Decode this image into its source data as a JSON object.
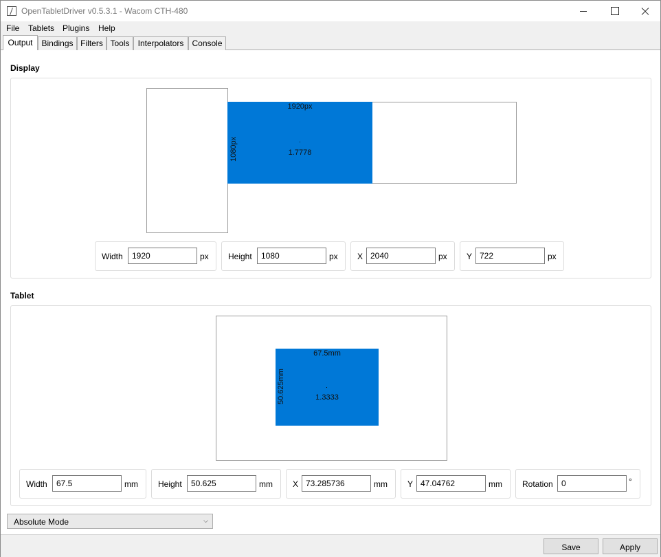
{
  "window": {
    "title": "OpenTabletDriver v0.5.3.1 - Wacom CTH-480"
  },
  "menu": [
    "File",
    "Tablets",
    "Plugins",
    "Help"
  ],
  "tabs": [
    "Output",
    "Bindings",
    "Filters",
    "Tools",
    "Interpolators",
    "Console"
  ],
  "display": {
    "label": "Display",
    "area": {
      "width_text": "1920px",
      "height_text": "1080px",
      "ratio": "1.7778"
    },
    "fields": {
      "width": {
        "label": "Width",
        "value": "1920",
        "unit": "px"
      },
      "height": {
        "label": "Height",
        "value": "1080",
        "unit": "px"
      },
      "x": {
        "label": "X",
        "value": "2040",
        "unit": "px"
      },
      "y": {
        "label": "Y",
        "value": "722",
        "unit": "px"
      }
    }
  },
  "tablet": {
    "label": "Tablet",
    "area": {
      "width_text": "67.5mm",
      "height_text": "50.625mm",
      "ratio": "1.3333"
    },
    "fields": {
      "width": {
        "label": "Width",
        "value": "67.5",
        "unit": "mm"
      },
      "height": {
        "label": "Height",
        "value": "50.625",
        "unit": "mm"
      },
      "x": {
        "label": "X",
        "value": "73.285736",
        "unit": "mm"
      },
      "y": {
        "label": "Y",
        "value": "47.04762",
        "unit": "mm"
      },
      "rotation": {
        "label": "Rotation",
        "value": "0",
        "unit": "°"
      }
    }
  },
  "mode": {
    "selected": "Absolute Mode"
  },
  "footer": {
    "save": "Save",
    "apply": "Apply"
  },
  "colors": {
    "area": "#0078d7",
    "chrome": "#f0f0f0"
  }
}
